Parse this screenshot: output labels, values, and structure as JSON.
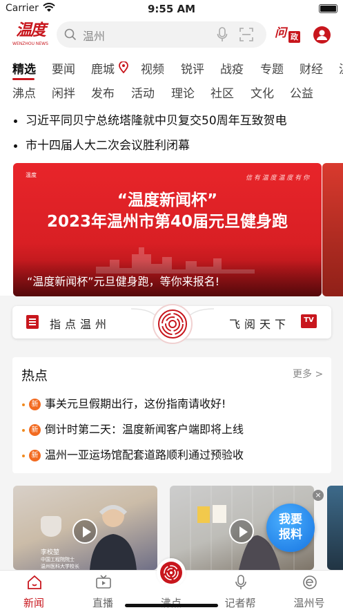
{
  "status_bar": {
    "carrier": "Carrier",
    "time": "9:55 AM"
  },
  "header": {
    "logo_text": "温度",
    "logo_sub": "WENZHOU NEWS",
    "search_placeholder": "温州",
    "wenzheng_q": "问",
    "wenzheng_box": "政"
  },
  "channels": {
    "row1": [
      "精选",
      "要闻",
      "鹿城",
      "视频",
      "锐评",
      "战疫",
      "专题",
      "财经",
      "温"
    ],
    "row2": [
      "沸点",
      "闲拌",
      "发布",
      "活动",
      "理论",
      "社区",
      "文化",
      "公益"
    ],
    "active": "精选"
  },
  "headlines": [
    "习近平同贝宁总统塔隆就中贝复交50周年互致贺电",
    "市十四届人大二次会议胜利闭幕"
  ],
  "banner": {
    "top_small": "温度",
    "calligraphy": "信 有 温 度 温 度 有 你",
    "title_line1": "“温度新闻杯”",
    "title_line2": "2023年温州市第40届元旦健身跑",
    "caption": "“温度新闻杯”元旦健身跑，等你来报名!"
  },
  "feature_bar": {
    "left_label": "指点温州",
    "right_label": "飞阅天下",
    "tv_badge": "TV"
  },
  "hot": {
    "title": "热点",
    "more": "更多 >",
    "badge": "新",
    "items": [
      "事关元旦假期出行，这份指南请收好!",
      "倒计时第二天：温度新闻客户端即将上线",
      "温州一亚运场馆配套道路顺利通过预验收"
    ]
  },
  "videos": {
    "nameplate_line1": "李校堃",
    "nameplate_line2": "中国工程院院士",
    "nameplate_line3": "温州医科大学校长",
    "baoliao_line1": "我要",
    "baoliao_line2": "报料",
    "close": "×"
  },
  "tabbar": [
    {
      "label": "新闻",
      "icon": "home-icon",
      "active": true
    },
    {
      "label": "直播",
      "icon": "tv-icon",
      "active": false
    },
    {
      "label": "沸点",
      "icon": "fingerprint-icon",
      "active": false
    },
    {
      "label": "记者帮",
      "icon": "mic-icon",
      "active": false
    },
    {
      "label": "温州号",
      "icon": "e-icon",
      "active": false
    }
  ],
  "colors": {
    "brand_red": "#c8161d",
    "badge_orange": "#f26b21",
    "baoliao_blue": "#1673e0"
  }
}
